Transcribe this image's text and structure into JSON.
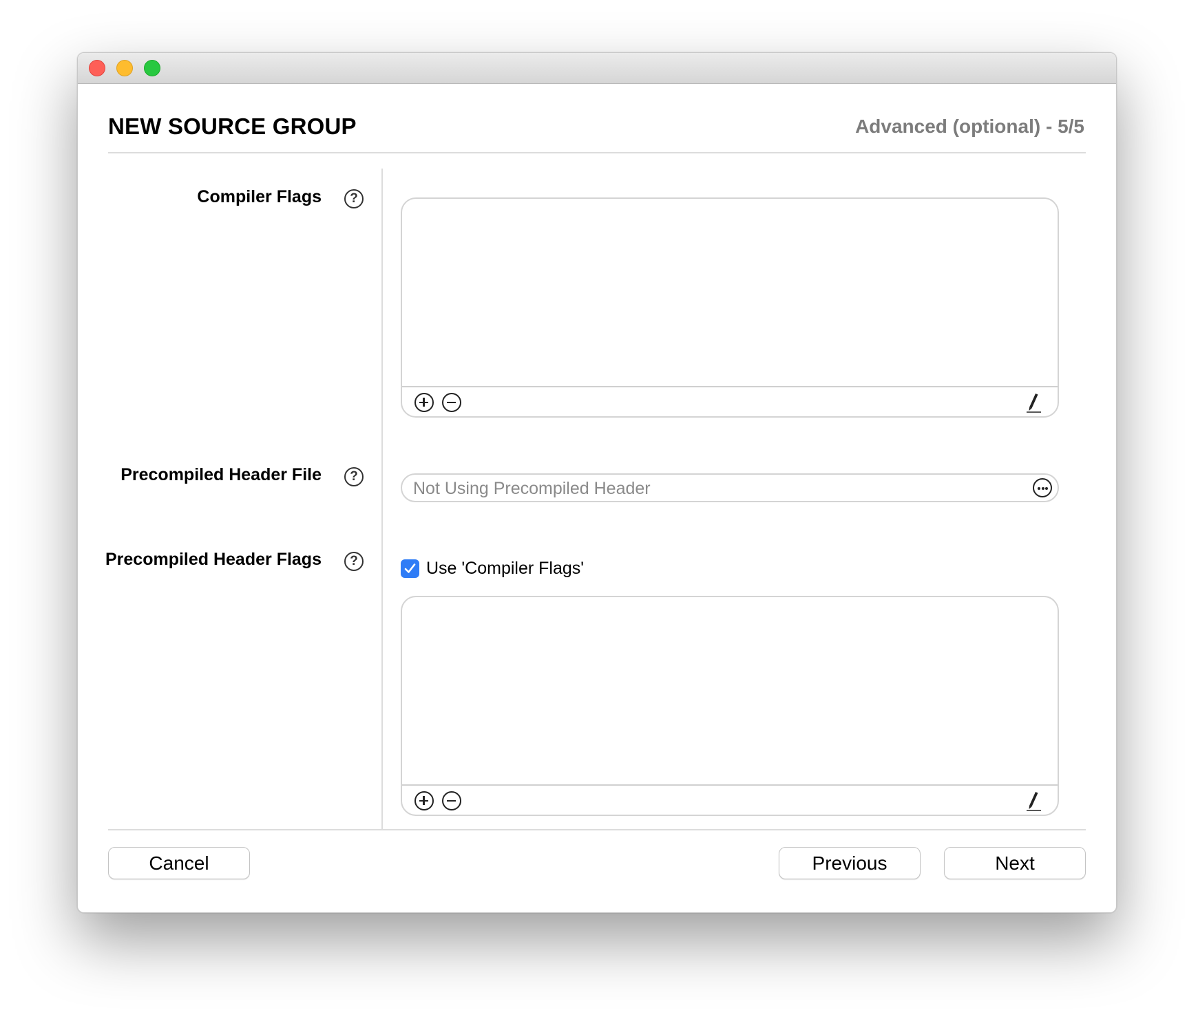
{
  "window": {
    "controls": [
      "close",
      "minimize",
      "zoom"
    ]
  },
  "header": {
    "title": "NEW SOURCE GROUP",
    "step": "Advanced (optional) - 5/5"
  },
  "fields": {
    "compiler_flags": {
      "label": "Compiler Flags",
      "help": "?",
      "items": []
    },
    "pch_file": {
      "label": "Precompiled Header File",
      "help": "?",
      "value": "",
      "placeholder": "Not Using Precompiled Header"
    },
    "pch_flags": {
      "label": "Precompiled Header Flags",
      "help": "?",
      "use_compiler_flags_label": "Use 'Compiler Flags'",
      "use_compiler_flags_checked": true,
      "items": []
    }
  },
  "icons": {
    "help": "question-mark-circle-icon",
    "add": "plus-circle-icon",
    "remove": "minus-circle-icon",
    "edit": "pencil-icon",
    "browse": "ellipsis-circle-icon",
    "check": "checkmark-icon"
  },
  "colors": {
    "accent": "#2f7cf6",
    "close": "#fe5f57",
    "minimize": "#febc2e",
    "zoom": "#28c840",
    "step_text": "#7c7c7c"
  },
  "footer": {
    "cancel": "Cancel",
    "previous": "Previous",
    "next": "Next"
  }
}
